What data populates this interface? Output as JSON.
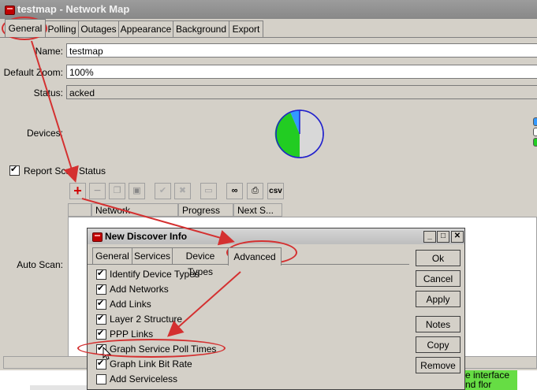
{
  "window": {
    "title": "testmap - Network Map"
  },
  "tabs": [
    "General",
    "Polling",
    "Outages",
    "Appearance",
    "Background",
    "Export"
  ],
  "form": {
    "name_label": "Name:",
    "name_value": "testmap",
    "zoom_label": "Default Zoom:",
    "zoom_value": "100%",
    "status_label": "Status:",
    "status_value": "acked",
    "devices_label": "Devices:",
    "report_scan_label": "Report Scan Status",
    "auto_scan_label": "Auto Scan:"
  },
  "toolbar": {
    "csv_label": "csv"
  },
  "table": {
    "columns": [
      "Network",
      "Progress",
      "Next S..."
    ]
  },
  "dialog": {
    "title": "New Discover Info",
    "tabs": [
      "General",
      "Services",
      "Device Types",
      "Advanced"
    ],
    "options": [
      {
        "label": "Identify Device Types",
        "checked": true
      },
      {
        "label": "Add Networks",
        "checked": true
      },
      {
        "label": "Add Links",
        "checked": true
      },
      {
        "label": "Layer 2 Structure",
        "checked": true
      },
      {
        "label": "PPP Links",
        "checked": true
      },
      {
        "label": "Graph Service Poll Times",
        "checked": true
      },
      {
        "label": "Graph Link Bit Rate",
        "checked": true
      },
      {
        "label": "Add Serviceless",
        "checked": false
      }
    ],
    "buttons": [
      "Ok",
      "Cancel",
      "Apply",
      "Notes",
      "Copy",
      "Remove"
    ]
  },
  "background_text": {
    "line1": "e interface",
    "line2": "nd flor"
  },
  "colors": {
    "annotation": "#d43030",
    "pie_green": "#22cc22",
    "pie_blue": "#3399ff",
    "pie_gray": "#d8d8d8"
  }
}
